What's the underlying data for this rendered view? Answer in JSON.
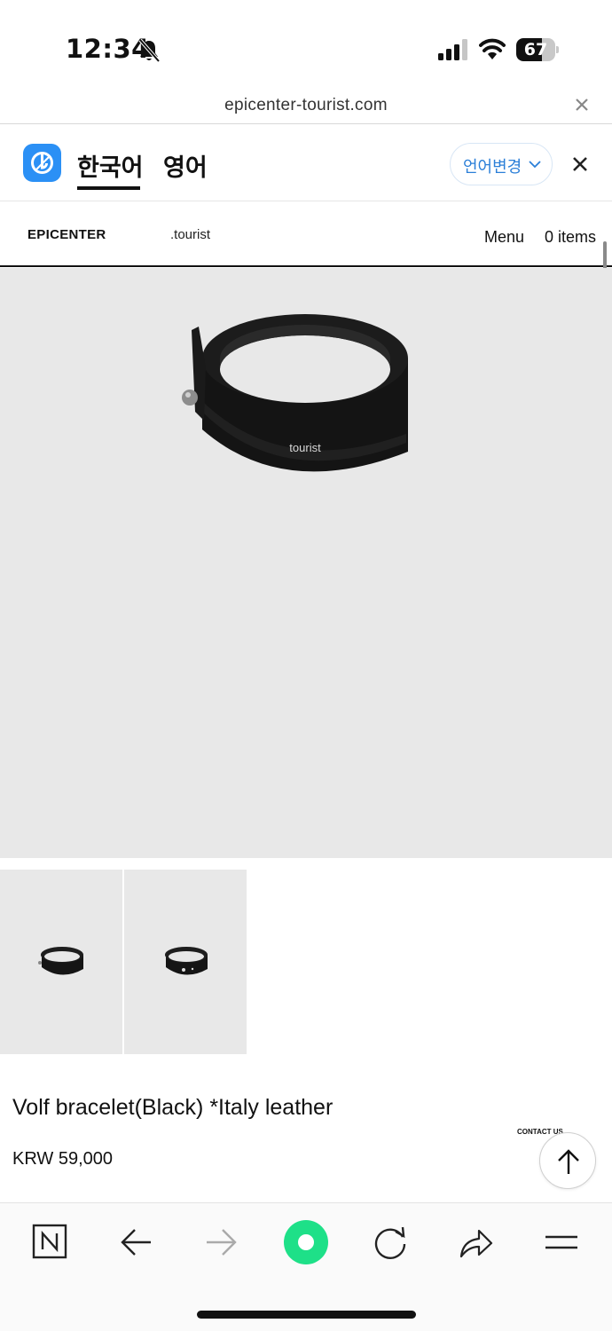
{
  "status_bar": {
    "time": "12:34",
    "battery_level": "67",
    "battery_fraction": 0.67
  },
  "browser": {
    "url": "epicenter-tourist.com"
  },
  "translate_bar": {
    "languages": [
      {
        "label": "한국어",
        "selected": true
      },
      {
        "label": "영어",
        "selected": false
      }
    ],
    "change_language_label": "언어변경",
    "accent_color": "#2b90f5"
  },
  "site_header": {
    "brand": "EPICENTER",
    "brand_sub": ".tourist",
    "menu_label": "Menu",
    "cart_label": "0 items"
  },
  "product": {
    "image_label": "tourist",
    "title": "Volf bracelet(Black) *Italy leather",
    "price": "KRW 59,000",
    "thumbnails": [
      "thumbnail-front",
      "thumbnail-back"
    ]
  },
  "floating": {
    "contact_label": "CONTACT US",
    "scroll_top_icon": "arrow-up-icon"
  },
  "toolbar": {
    "icons": [
      "naver-n-icon",
      "back-arrow-icon",
      "forward-arrow-icon",
      "green-dot-home-icon",
      "reload-icon",
      "share-icon",
      "hamburger-menu-icon"
    ],
    "green_color": "#1ee088"
  }
}
